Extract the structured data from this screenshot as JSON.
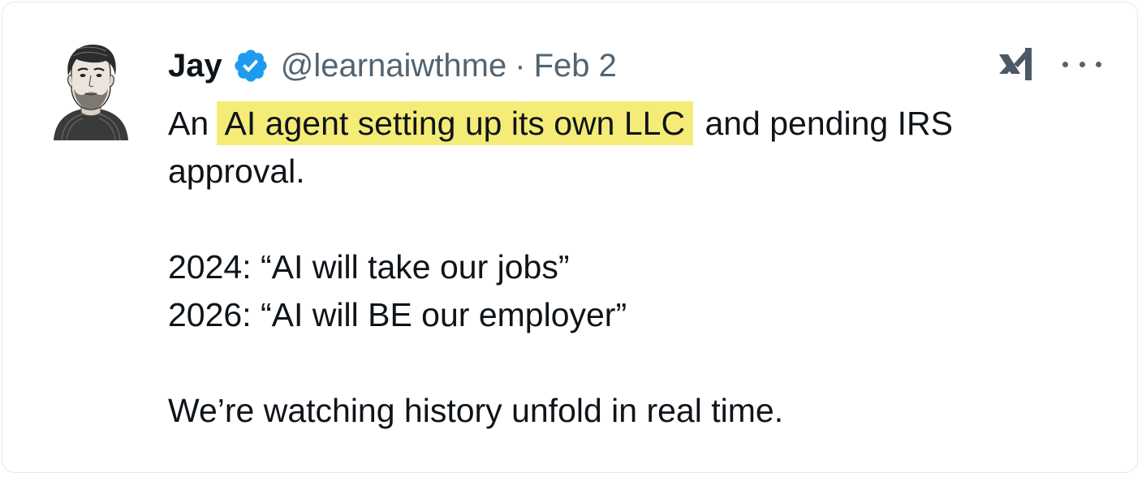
{
  "tweet": {
    "author_name": "Jay",
    "handle": "@learnaiwthme",
    "separator": "·",
    "date": "Feb 2",
    "text": {
      "line1_prefix": "An ",
      "line1_highlight": "AI agent setting up its own LLC",
      "line1_suffix": " and pending IRS approval.",
      "line2": "2024: “AI will take our jobs”",
      "line3": "2026: “AI will BE our employer”",
      "line4": "We’re watching history unfold in real time."
    }
  },
  "icons": {
    "avatar": "avatar-illustration",
    "verified": "verified-badge-icon",
    "brand": "xai-logo-icon",
    "more": "more-options-icon"
  },
  "colors": {
    "verified_blue": "#1d9bf0",
    "highlight_yellow": "#f5ec78",
    "secondary_text": "#536471",
    "primary_text": "#0f1419",
    "card_border": "#e6e8eb"
  }
}
